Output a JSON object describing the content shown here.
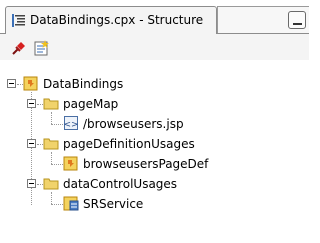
{
  "tab": {
    "title": "DataBindings.cpx - Structure"
  },
  "toolbar": {
    "icons": [
      "pin-icon",
      "properties-icon"
    ]
  },
  "tree": {
    "root": {
      "label": "DataBindings",
      "icon": "databindings-icon"
    },
    "groups": [
      {
        "label": "pageMap",
        "icon": "folder-icon",
        "children": [
          {
            "label": "/browseusers.jsp",
            "icon": "jsp-page-icon"
          }
        ]
      },
      {
        "label": "pageDefinitionUsages",
        "icon": "folder-icon",
        "children": [
          {
            "label": "browseusersPageDef",
            "icon": "pagedef-icon"
          }
        ]
      },
      {
        "label": "dataControlUsages",
        "icon": "folder-icon",
        "children": [
          {
            "label": "SRService",
            "icon": "datacontrol-icon"
          }
        ]
      }
    ]
  },
  "colors": {
    "folder": "#f1d36b",
    "tab_bg": "#f4f4f4",
    "pin": "#d62020"
  }
}
